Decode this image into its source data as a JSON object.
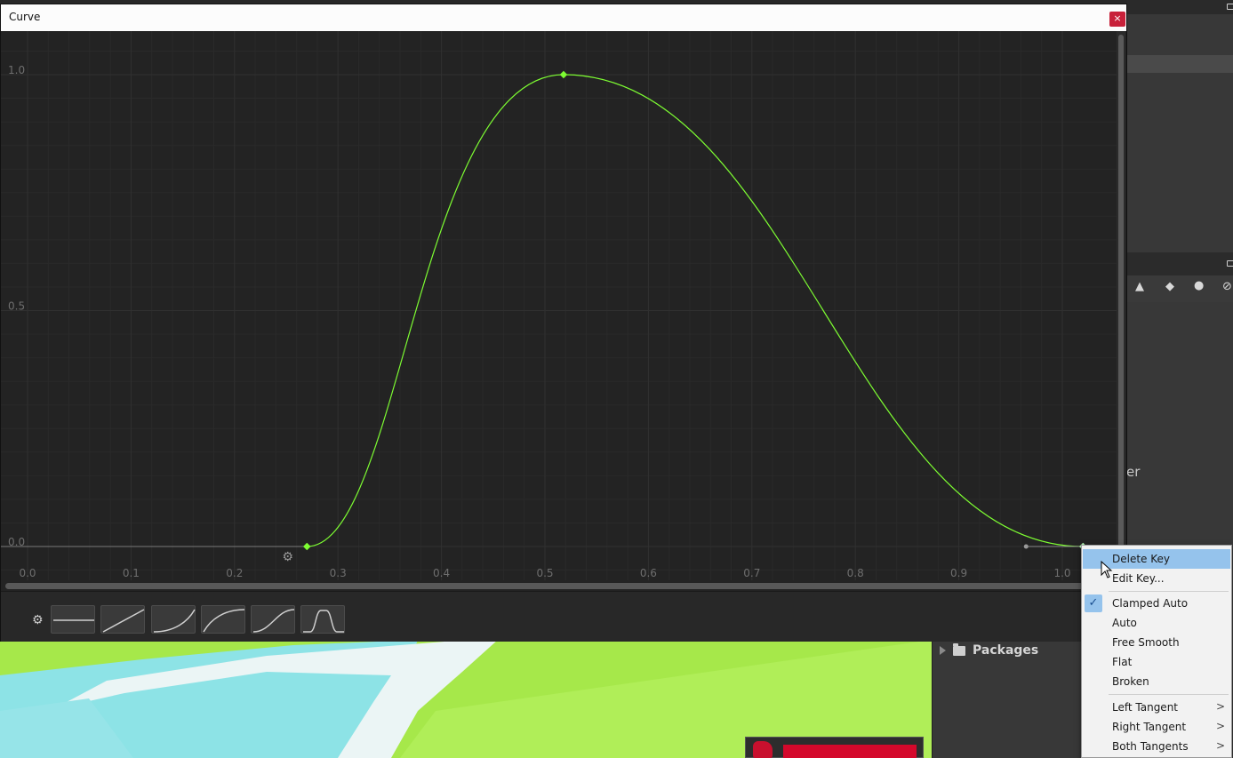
{
  "window": {
    "title": "Curve",
    "close_glyph": "×"
  },
  "graph": {
    "y_labels": [
      "1.0",
      "0.5",
      "0.0"
    ],
    "x_labels": [
      "0.0",
      "0.1",
      "0.2",
      "0.3",
      "0.4",
      "0.5",
      "0.6",
      "0.7",
      "0.8",
      "0.9",
      "1.0"
    ],
    "curve_color": "#7dfc32",
    "keys": [
      {
        "t": 0.27,
        "v": 0.0
      },
      {
        "t": 0.518,
        "v": 1.0
      },
      {
        "t": 1.02,
        "v": 0.0
      }
    ],
    "selected_key_index": 2,
    "preset_count": 6
  },
  "context_menu": {
    "items": {
      "delete_key": "Delete Key",
      "edit_key": "Edit Key...",
      "clamped_auto": "Clamped Auto",
      "auto": "Auto",
      "free_smooth": "Free Smooth",
      "flat": "Flat",
      "broken": "Broken",
      "left_tangent": "Left Tangent",
      "right_tangent": "Right Tangent",
      "both_tangents": "Both Tangents"
    },
    "checked": "Clamped Auto",
    "highlighted": "Delete Key",
    "submenu_arrow": ">"
  },
  "project": {
    "packages_label": "Packages"
  },
  "background": {
    "partial_text": "er"
  }
}
